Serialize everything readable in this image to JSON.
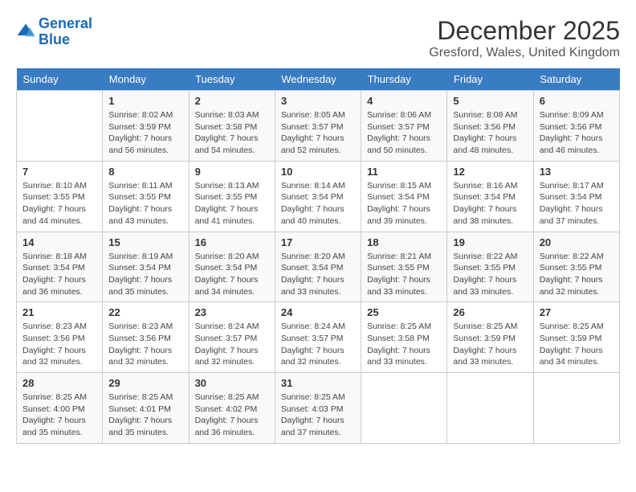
{
  "logo": {
    "line1": "General",
    "line2": "Blue"
  },
  "title": "December 2025",
  "subtitle": "Gresford, Wales, United Kingdom",
  "days_of_week": [
    "Sunday",
    "Monday",
    "Tuesday",
    "Wednesday",
    "Thursday",
    "Friday",
    "Saturday"
  ],
  "weeks": [
    [
      {
        "day": "",
        "content": ""
      },
      {
        "day": "1",
        "content": "Sunrise: 8:02 AM\nSunset: 3:59 PM\nDaylight: 7 hours\nand 56 minutes."
      },
      {
        "day": "2",
        "content": "Sunrise: 8:03 AM\nSunset: 3:58 PM\nDaylight: 7 hours\nand 54 minutes."
      },
      {
        "day": "3",
        "content": "Sunrise: 8:05 AM\nSunset: 3:57 PM\nDaylight: 7 hours\nand 52 minutes."
      },
      {
        "day": "4",
        "content": "Sunrise: 8:06 AM\nSunset: 3:57 PM\nDaylight: 7 hours\nand 50 minutes."
      },
      {
        "day": "5",
        "content": "Sunrise: 8:08 AM\nSunset: 3:56 PM\nDaylight: 7 hours\nand 48 minutes."
      },
      {
        "day": "6",
        "content": "Sunrise: 8:09 AM\nSunset: 3:56 PM\nDaylight: 7 hours\nand 46 minutes."
      }
    ],
    [
      {
        "day": "7",
        "content": "Sunrise: 8:10 AM\nSunset: 3:55 PM\nDaylight: 7 hours\nand 44 minutes."
      },
      {
        "day": "8",
        "content": "Sunrise: 8:11 AM\nSunset: 3:55 PM\nDaylight: 7 hours\nand 43 minutes."
      },
      {
        "day": "9",
        "content": "Sunrise: 8:13 AM\nSunset: 3:55 PM\nDaylight: 7 hours\nand 41 minutes."
      },
      {
        "day": "10",
        "content": "Sunrise: 8:14 AM\nSunset: 3:54 PM\nDaylight: 7 hours\nand 40 minutes."
      },
      {
        "day": "11",
        "content": "Sunrise: 8:15 AM\nSunset: 3:54 PM\nDaylight: 7 hours\nand 39 minutes."
      },
      {
        "day": "12",
        "content": "Sunrise: 8:16 AM\nSunset: 3:54 PM\nDaylight: 7 hours\nand 38 minutes."
      },
      {
        "day": "13",
        "content": "Sunrise: 8:17 AM\nSunset: 3:54 PM\nDaylight: 7 hours\nand 37 minutes."
      }
    ],
    [
      {
        "day": "14",
        "content": "Sunrise: 8:18 AM\nSunset: 3:54 PM\nDaylight: 7 hours\nand 36 minutes."
      },
      {
        "day": "15",
        "content": "Sunrise: 8:19 AM\nSunset: 3:54 PM\nDaylight: 7 hours\nand 35 minutes."
      },
      {
        "day": "16",
        "content": "Sunrise: 8:20 AM\nSunset: 3:54 PM\nDaylight: 7 hours\nand 34 minutes."
      },
      {
        "day": "17",
        "content": "Sunrise: 8:20 AM\nSunset: 3:54 PM\nDaylight: 7 hours\nand 33 minutes."
      },
      {
        "day": "18",
        "content": "Sunrise: 8:21 AM\nSunset: 3:55 PM\nDaylight: 7 hours\nand 33 minutes."
      },
      {
        "day": "19",
        "content": "Sunrise: 8:22 AM\nSunset: 3:55 PM\nDaylight: 7 hours\nand 33 minutes."
      },
      {
        "day": "20",
        "content": "Sunrise: 8:22 AM\nSunset: 3:55 PM\nDaylight: 7 hours\nand 32 minutes."
      }
    ],
    [
      {
        "day": "21",
        "content": "Sunrise: 8:23 AM\nSunset: 3:56 PM\nDaylight: 7 hours\nand 32 minutes."
      },
      {
        "day": "22",
        "content": "Sunrise: 8:23 AM\nSunset: 3:56 PM\nDaylight: 7 hours\nand 32 minutes."
      },
      {
        "day": "23",
        "content": "Sunrise: 8:24 AM\nSunset: 3:57 PM\nDaylight: 7 hours\nand 32 minutes."
      },
      {
        "day": "24",
        "content": "Sunrise: 8:24 AM\nSunset: 3:57 PM\nDaylight: 7 hours\nand 32 minutes."
      },
      {
        "day": "25",
        "content": "Sunrise: 8:25 AM\nSunset: 3:58 PM\nDaylight: 7 hours\nand 33 minutes."
      },
      {
        "day": "26",
        "content": "Sunrise: 8:25 AM\nSunset: 3:59 PM\nDaylight: 7 hours\nand 33 minutes."
      },
      {
        "day": "27",
        "content": "Sunrise: 8:25 AM\nSunset: 3:59 PM\nDaylight: 7 hours\nand 34 minutes."
      }
    ],
    [
      {
        "day": "28",
        "content": "Sunrise: 8:25 AM\nSunset: 4:00 PM\nDaylight: 7 hours\nand 35 minutes."
      },
      {
        "day": "29",
        "content": "Sunrise: 8:25 AM\nSunset: 4:01 PM\nDaylight: 7 hours\nand 35 minutes."
      },
      {
        "day": "30",
        "content": "Sunrise: 8:25 AM\nSunset: 4:02 PM\nDaylight: 7 hours\nand 36 minutes."
      },
      {
        "day": "31",
        "content": "Sunrise: 8:25 AM\nSunset: 4:03 PM\nDaylight: 7 hours\nand 37 minutes."
      },
      {
        "day": "",
        "content": ""
      },
      {
        "day": "",
        "content": ""
      },
      {
        "day": "",
        "content": ""
      }
    ]
  ]
}
